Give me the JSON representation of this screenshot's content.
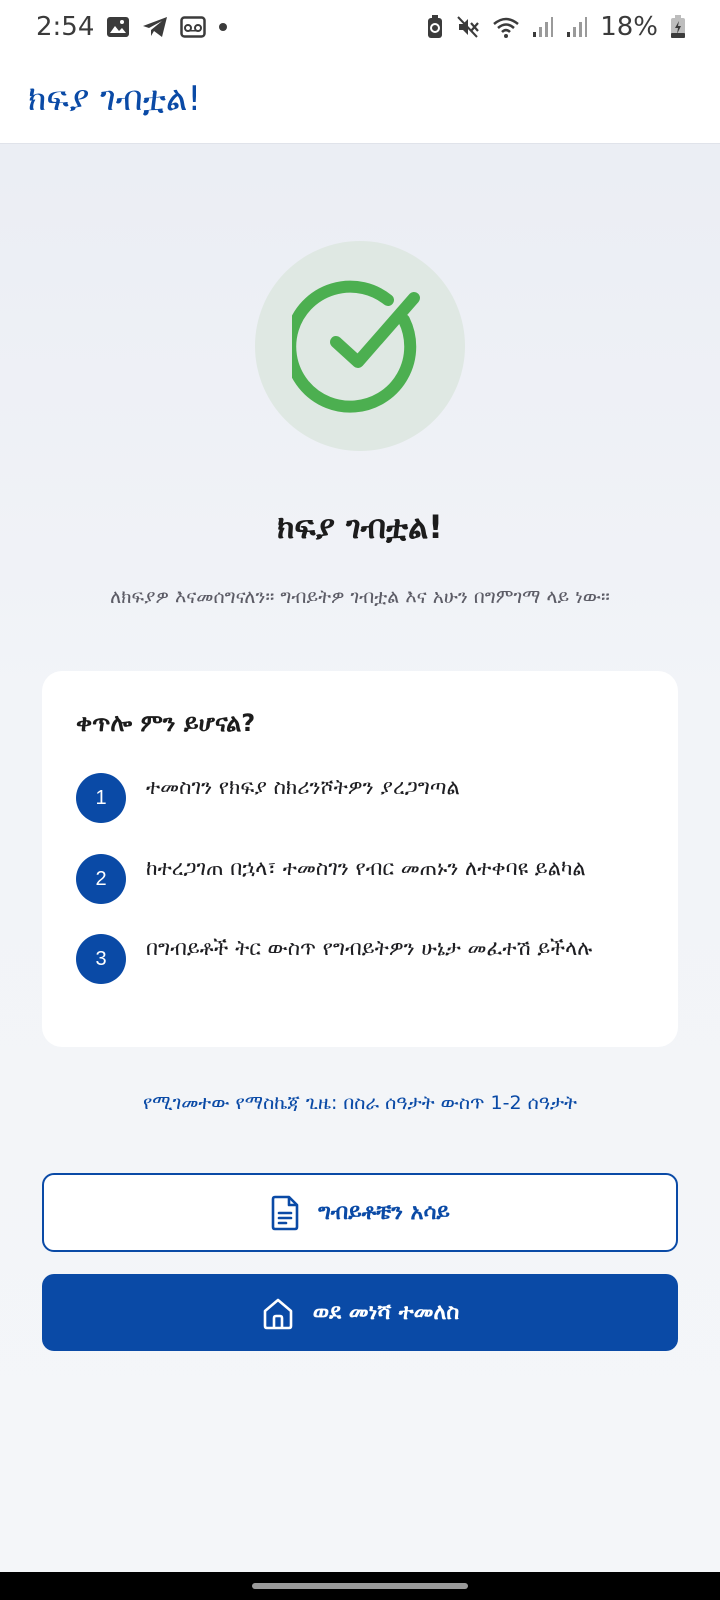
{
  "status_bar": {
    "time": "2:54",
    "battery": "18%",
    "left_icons": [
      "gallery-icon",
      "telegram-icon",
      "voicemail-icon",
      "dot-icon"
    ],
    "right_icons": [
      "battery-saver-icon",
      "mute-icon",
      "wifi-icon",
      "signal-icon",
      "signal-icon",
      "battery-icon"
    ]
  },
  "app_bar": {
    "title": "ክፍያ ገብቷል!"
  },
  "success": {
    "icon": "check-circle-icon",
    "headline": "ክፍያ ገብቷል!",
    "subtext": "ለክፍያዎ እናመሰግናለን። ግብይትዎ ገብቷል እና አሁን በግምገማ ላይ ነው።"
  },
  "next_steps": {
    "title": "ቀጥሎ ምን ይሆናል?",
    "steps": [
      {
        "number": "1",
        "text": "ተመስገን የክፍያ ስክሪንሾትዎን ያረጋግጣል"
      },
      {
        "number": "2",
        "text": "ከተረጋገጠ በኋላ፣ ተመስገን የብር መጠኑን ለተቀባዩ ይልካል"
      },
      {
        "number": "3",
        "text": "በግብይቶች ትር ውስጥ የግብይትዎን ሁኔታ መፈተሽ ይችላሉ"
      }
    ]
  },
  "eta": "የሚገመተው የማስኬጃ ጊዜ: በስራ ሰዓታት ውስጥ 1-2 ሰዓታት",
  "buttons": {
    "view_transactions": {
      "label": "ግብይቶቼን አሳይ",
      "icon": "document-icon"
    },
    "back_home": {
      "label": "ወደ መነሻ ተመለስ",
      "icon": "home-icon"
    }
  },
  "colors": {
    "primary": "#0a4aa6",
    "success": "#4caf50",
    "success_bg": "#dfe8e3"
  }
}
